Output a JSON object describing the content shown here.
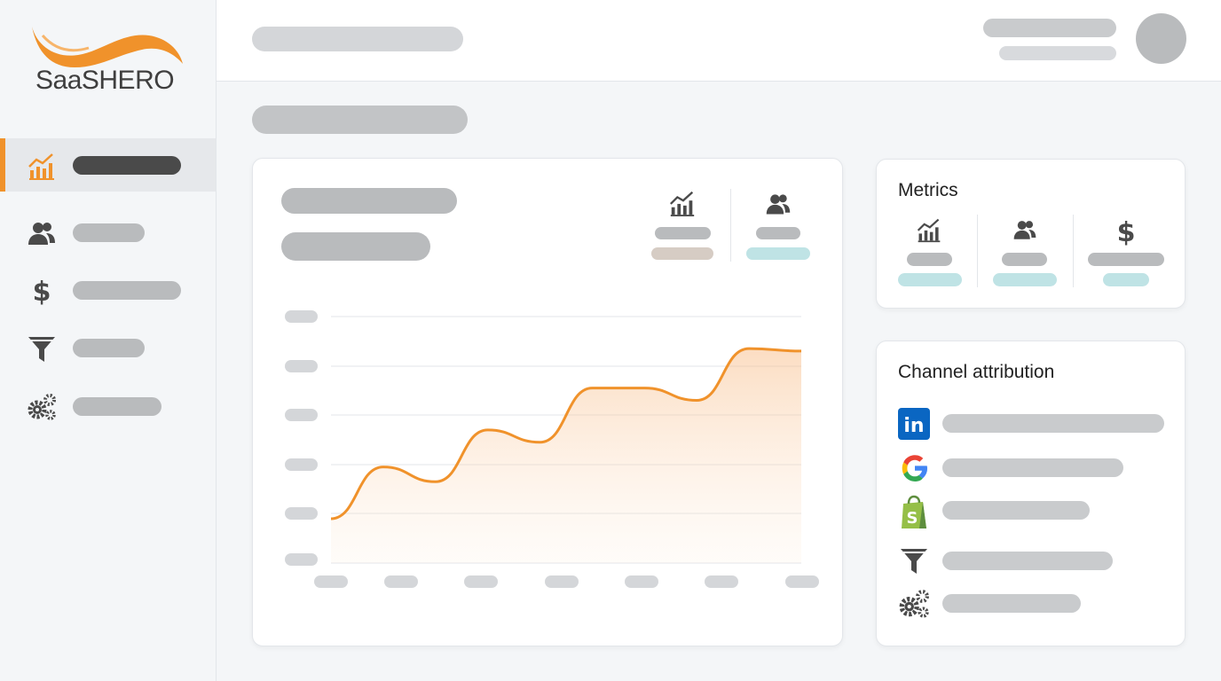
{
  "brand": {
    "name": "SaaSHERO",
    "accent_color": "#f0922b"
  },
  "sidebar": {
    "items": [
      {
        "icon": "chart-icon",
        "active": true
      },
      {
        "icon": "users-icon",
        "active": false
      },
      {
        "icon": "dollar-icon",
        "active": false
      },
      {
        "icon": "funnel-icon",
        "active": false
      },
      {
        "icon": "gears-icon",
        "active": false
      }
    ]
  },
  "chart_panel": {
    "kpis": [
      {
        "icon": "chart-icon",
        "badge_color": "#d6ccc4"
      },
      {
        "icon": "users-icon",
        "badge_color": "#bfe3e5"
      }
    ],
    "chart_data": {
      "type": "area",
      "color": "#f0922b",
      "grid": true,
      "x": [
        0,
        1,
        2,
        3,
        4,
        5,
        6,
        7,
        8,
        9
      ],
      "y_fraction": [
        0.18,
        0.39,
        0.33,
        0.54,
        0.49,
        0.71,
        0.71,
        0.66,
        0.87,
        0.86
      ],
      "ylim": [
        0,
        1
      ]
    }
  },
  "metrics": {
    "title": "Metrics",
    "items": [
      {
        "icon": "chart-icon",
        "badge_color": "#bfe3e5"
      },
      {
        "icon": "users-icon",
        "badge_color": "#bfe3e5"
      },
      {
        "icon": "dollar-icon",
        "badge_color": "#bfe3e5"
      }
    ]
  },
  "channels": {
    "title": "Channel attribution",
    "items": [
      {
        "icon": "linkedin-icon"
      },
      {
        "icon": "google-icon"
      },
      {
        "icon": "shopify-icon"
      },
      {
        "icon": "funnel-icon"
      },
      {
        "icon": "gears-icon"
      }
    ]
  }
}
